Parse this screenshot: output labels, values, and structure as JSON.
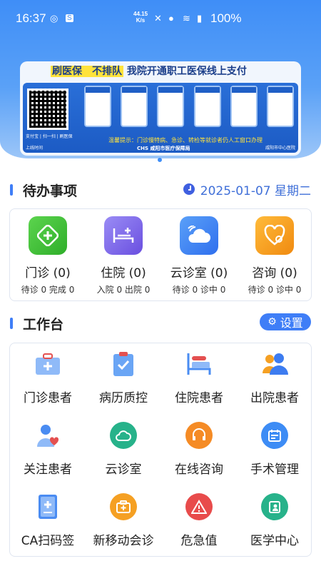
{
  "status_bar": {
    "time": "16:37",
    "speed_value": "44.15",
    "speed_unit": "K/s",
    "battery": "100%"
  },
  "banner": {
    "highlight_text": "刷医保　不排队",
    "title_rest": "我院开通职工医保线上支付",
    "qr_caption": "支付宝 | 扫一扫 | 刷医保",
    "tip": "温馨提示：门诊慢特病、急诊、转检等就诊者仍人工窗口办理",
    "org": "CHS 咸阳市医疗保障局",
    "footer_left": "上线时间",
    "footer_right": "咸阳市中心医院"
  },
  "todo": {
    "title": "待办事项",
    "date": "2025-01-07 星期二",
    "items": [
      {
        "label": "门诊 (0)",
        "sub": "待诊 0 完成 0",
        "icon": "outpatient-cross-icon",
        "color": "#3fbf3a"
      },
      {
        "label": "住院 (0)",
        "sub": "入院 0 出院 0",
        "icon": "hospital-bed-icon",
        "color": "#7a63e8"
      },
      {
        "label": "云诊室 (0)",
        "sub": "待诊 0 诊中 0",
        "icon": "cloud-clinic-icon",
        "color": "#3d84f5"
      },
      {
        "label": "咨询 (0)",
        "sub": "待诊 0 诊中 0",
        "icon": "consult-heart-icon",
        "color": "#f5a023"
      }
    ]
  },
  "workbench": {
    "title": "工作台",
    "settings_label": "设置",
    "items": [
      {
        "label": "门诊患者",
        "icon": "outpatient-kit-icon",
        "color": "#6aa5f5"
      },
      {
        "label": "病历质控",
        "icon": "clipboard-check-icon",
        "color": "#4a8cf2"
      },
      {
        "label": "住院患者",
        "icon": "inpatient-bed-icon",
        "color": "#e45050"
      },
      {
        "label": "出院患者",
        "icon": "discharge-users-icon",
        "color": "#3d7cf0"
      },
      {
        "label": "关注患者",
        "icon": "followed-patient-icon",
        "color": "#4a8cf2"
      },
      {
        "label": "云诊室",
        "icon": "cloud-room-icon",
        "color": "#27b28a"
      },
      {
        "label": "在线咨询",
        "icon": "headset-icon",
        "color": "#f58b25"
      },
      {
        "label": "手术管理",
        "icon": "surgery-calendar-icon",
        "color": "#3d8cf5"
      },
      {
        "label": "CA扫码签",
        "icon": "ca-book-icon",
        "color": "#4a8cf2"
      },
      {
        "label": "新移动会诊",
        "icon": "mobile-consult-icon",
        "color": "#f5a023"
      },
      {
        "label": "危急值",
        "icon": "critical-alert-icon",
        "color": "#e84b4b"
      },
      {
        "label": "医学中心",
        "icon": "medical-center-icon",
        "color": "#27b28a"
      }
    ]
  }
}
